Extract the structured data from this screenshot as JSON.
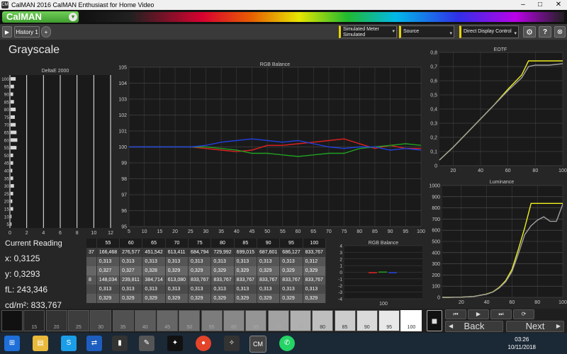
{
  "window": {
    "app_icon": "CM",
    "title": "CalMAN 2016 CalMAN Enthusiast for Home Video",
    "minimize": "–",
    "maximize": "□",
    "close": "✕"
  },
  "menubar": {
    "logo": "CalMAN",
    "logo_dropdown_icon": "▾"
  },
  "toolbar": {
    "back_icon": "▶",
    "history_tab": "History 1",
    "add_tab": "+",
    "meter_dropdown": [
      "Simulated Meter",
      "Simulated"
    ],
    "source_dropdown": "Source",
    "display_dropdown": "Direct Display Control",
    "dropdown_arrow": "▾",
    "settings_icon": "⚙",
    "help_icon": "?",
    "exit_icon": "⊗"
  },
  "page": {
    "title": "Grayscale"
  },
  "colors": {
    "red": "#e02020",
    "green": "#20a020",
    "blue": "#2040e0",
    "yellow": "#f0f020",
    "gray": "#a0a0a0"
  },
  "chart_data": [
    {
      "type": "bar",
      "title": "DeltaE 2000",
      "orientation": "horizontal",
      "categories": [
        "100",
        "95",
        "90",
        "85",
        "80",
        "75",
        "70",
        "65",
        "60",
        "55",
        "50",
        "45",
        "40",
        "35",
        "30",
        "25",
        "20",
        "15",
        "10",
        "5"
      ],
      "values": [
        0.6,
        0.4,
        0.3,
        0.4,
        0.6,
        0.5,
        0.6,
        0.7,
        0.8,
        0.7,
        0.3,
        0.3,
        0.2,
        0.3,
        0.4,
        0.3,
        0.2,
        0.3,
        0.1,
        0.1
      ],
      "xlim": [
        0,
        12
      ],
      "xticks": [
        "0",
        "2",
        "4",
        "6",
        "8",
        "10",
        "12"
      ]
    },
    {
      "type": "line",
      "title": "RGB Balance",
      "x": [
        5,
        10,
        15,
        20,
        25,
        30,
        35,
        40,
        45,
        50,
        55,
        60,
        65,
        70,
        75,
        80,
        85,
        90,
        95,
        100
      ],
      "series": [
        {
          "color": "#e02020",
          "values": [
            100,
            100,
            100,
            100,
            100,
            99.9,
            99.8,
            99.7,
            99.8,
            100.1,
            100.1,
            100.2,
            100.3,
            100.4,
            100.5,
            100.2,
            99.9,
            100.1,
            99.9,
            99.9
          ]
        },
        {
          "color": "#20a020",
          "values": [
            100,
            100,
            100,
            100,
            100,
            100,
            99.9,
            99.8,
            99.6,
            99.6,
            99.5,
            99.4,
            99.5,
            99.6,
            99.6,
            99.9,
            100,
            100.1,
            100.2,
            100.1
          ]
        },
        {
          "color": "#2040e0",
          "values": [
            100,
            100,
            100,
            100,
            100,
            100.1,
            100.3,
            100.4,
            100.5,
            100.4,
            100.3,
            100.4,
            100.2,
            100,
            99.9,
            100,
            100,
            99.8,
            99.9,
            99.8
          ]
        }
      ],
      "ylim": [
        95,
        105
      ],
      "yticks": [
        "95",
        "96",
        "97",
        "98",
        "99",
        "100",
        "101",
        "102",
        "103",
        "104",
        "105"
      ],
      "xticks": [
        "5",
        "10",
        "15",
        "20",
        "25",
        "30",
        "35",
        "40",
        "45",
        "50",
        "55",
        "60",
        "65",
        "70",
        "75",
        "80",
        "85",
        "90",
        "95",
        "100"
      ]
    },
    {
      "type": "line",
      "title": "EOTF",
      "x": [
        10,
        20,
        30,
        40,
        50,
        60,
        70,
        75,
        80,
        90,
        100
      ],
      "series": [
        {
          "color": "#f0f020",
          "values": [
            0.04,
            0.13,
            0.23,
            0.33,
            0.43,
            0.54,
            0.64,
            0.74,
            0.74,
            0.74,
            0.74
          ]
        },
        {
          "color": "#a0a0a0",
          "values": [
            0.04,
            0.13,
            0.23,
            0.33,
            0.43,
            0.53,
            0.62,
            0.7,
            0.71,
            0.71,
            0.72
          ]
        }
      ],
      "ylim": [
        0,
        0.8
      ],
      "yticks": [
        "0",
        "0,1",
        "0,2",
        "0,3",
        "0,4",
        "0,5",
        "0,6",
        "0,7",
        "0,8"
      ],
      "xticks": [
        "20",
        "40",
        "60",
        "80",
        "100"
      ]
    },
    {
      "type": "line",
      "title": "Luminance",
      "x": [
        5,
        10,
        20,
        30,
        40,
        45,
        50,
        55,
        60,
        65,
        70,
        75,
        80,
        85,
        90,
        95,
        100
      ],
      "series": [
        {
          "color": "#f0f020",
          "values": [
            0,
            0,
            2,
            8,
            30,
            50,
            90,
            150,
            250,
            430,
            620,
            840,
            840,
            840,
            840,
            840,
            840
          ]
        },
        {
          "color": "#a0a0a0",
          "values": [
            0,
            0,
            2,
            8,
            28,
            48,
            85,
            140,
            230,
            390,
            560,
            640,
            690,
            720,
            680,
            680,
            833
          ]
        }
      ],
      "ylim": [
        0,
        1000
      ],
      "yticks": [
        "0",
        "100",
        "200",
        "300",
        "400",
        "500",
        "600",
        "700",
        "800",
        "900",
        "1000"
      ],
      "xticks": [
        "20",
        "40",
        "60",
        "80",
        "100"
      ]
    },
    {
      "type": "bar",
      "title": "RGB Balance",
      "categories": [
        "100"
      ],
      "series": [
        {
          "color": "#e02020",
          "values": [
            -0.1
          ]
        },
        {
          "color": "#20a020",
          "values": [
            0.1
          ]
        },
        {
          "color": "#2040e0",
          "values": [
            -0.1
          ]
        }
      ],
      "ylim": [
        -4,
        4
      ],
      "yticks": [
        "4",
        "3",
        "2",
        "1",
        "0",
        "-1",
        "-2",
        "-3",
        "-4"
      ],
      "xticks": [
        "100"
      ]
    }
  ],
  "reading": {
    "heading": "Current Reading",
    "x": "x: 0,3125",
    "y": "y: 0,3293",
    "fl": "fL: 243,346",
    "cdm2": "cd/m²: 833,767"
  },
  "table": {
    "headers": [
      "",
      "55",
      "60",
      "65",
      "70",
      "75",
      "80",
      "85",
      "90",
      "95",
      "100"
    ],
    "rows": [
      [
        "37",
        "166,468",
        "276,577",
        "451,542",
        "613,411",
        "684,794",
        "729,992",
        "699,015",
        "687,601",
        "686,127",
        "833,767"
      ],
      [
        "",
        "0,313",
        "0,313",
        "0,313",
        "0,313",
        "0,313",
        "0,313",
        "0,313",
        "0,313",
        "0,313",
        "0,312"
      ],
      [
        "",
        "0,327",
        "0,327",
        "0,328",
        "0,329",
        "0,329",
        "0,329",
        "0,329",
        "0,329",
        "0,329",
        "0,329"
      ],
      [
        "8",
        "148,034",
        "239,811",
        "384,714",
        "613,080",
        "833,767",
        "833,767",
        "833,767",
        "833,767",
        "833,767",
        "833,767"
      ],
      [
        "",
        "0,313",
        "0,313",
        "0,313",
        "0,313",
        "0,313",
        "0,313",
        "0,313",
        "0,313",
        "0,313",
        "0,313"
      ],
      [
        "",
        "0,329",
        "0,329",
        "0,329",
        "0,329",
        "0,329",
        "0,329",
        "0,329",
        "0,329",
        "0,329",
        "0,329"
      ]
    ]
  },
  "swatches": [
    {
      "label": "",
      "color": "#111111"
    },
    {
      "label": "15",
      "color": "#262626"
    },
    {
      "label": "20",
      "color": "#333333"
    },
    {
      "label": "25",
      "color": "#3d3d3d"
    },
    {
      "label": "30",
      "color": "#474747"
    },
    {
      "label": "35",
      "color": "#515151"
    },
    {
      "label": "40",
      "color": "#5b5b5b"
    },
    {
      "label": "45",
      "color": "#666666"
    },
    {
      "label": "50",
      "color": "#717171"
    },
    {
      "label": "55",
      "color": "#7c7c7c"
    },
    {
      "label": "60",
      "color": "#888888"
    },
    {
      "label": "65",
      "color": "#959595"
    },
    {
      "label": "70",
      "color": "#a2a2a2"
    },
    {
      "label": "75",
      "color": "#b0b0b0"
    },
    {
      "label": "80",
      "color": "#bebebe"
    },
    {
      "label": "85",
      "color": "#cccccc"
    },
    {
      "label": "90",
      "color": "#dadada"
    },
    {
      "label": "95",
      "color": "#e8e8e8"
    },
    {
      "label": "100",
      "color": "#ffffff"
    }
  ],
  "nav": {
    "back": "Back",
    "next": "Next",
    "stop_icon": "■",
    "first_icon": "⏮",
    "play_icon": "▶",
    "playall_icon": "⏭",
    "loop_icon": "⟳",
    "left_arrow": "◀",
    "right_arrow": "▶"
  },
  "taskbar": {
    "time": "03:26",
    "date": "10/11/2018",
    "cm_label": "CM"
  }
}
